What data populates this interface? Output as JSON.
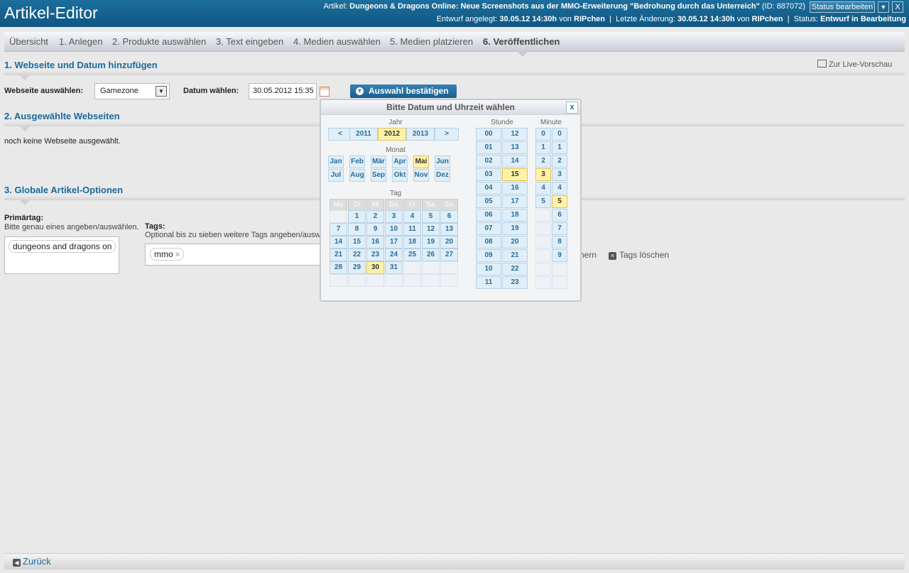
{
  "app": {
    "title": "Artikel-Editor"
  },
  "article": {
    "label": "Artikel:",
    "title": "Dungeons & Dragons Online: Neue Screenshots aus der MMO-Erweiterung \"Bedrohung durch das Unterreich\"",
    "id_text": "(ID: 887072)",
    "status_button": "Status bearbeiten",
    "draft_label": "Entwurf angelegt:",
    "draft_date": "30.05.12 14:30h",
    "by": "von",
    "draft_user": "RIPchen",
    "change_label": "Letzte Änderung:",
    "change_date": "30.05.12 14:30h",
    "change_user": "RIPchen",
    "status_label": "Status:",
    "status_value": "Entwurf in Bearbeitung"
  },
  "tabs": [
    "Übersicht",
    "1. Anlegen",
    "2. Produkte auswählen",
    "3. Text eingeben",
    "4. Medien auswählen",
    "5. Medien platzieren",
    "6. Veröffentlichen"
  ],
  "section1": {
    "title": "1. Webseite und Datum hinzufügen",
    "live_preview": "Zur Live-Vorschau",
    "website_label": "Webseite auswählen:",
    "website_value": "Gamezone",
    "date_label": "Datum wählen:",
    "date_value": "30.05.2012 15:35",
    "confirm_button": "Auswahl bestätigen"
  },
  "section2": {
    "title": "2. Ausgewählte Webseiten",
    "empty_note": "noch keine Webseite ausgewählt."
  },
  "section3": {
    "title": "3. Globale Artikel-Optionen",
    "primary_label": "Primärtag:",
    "primary_hint": "Bitte genau eines angeben/auswählen.",
    "primary_value": "dungeons and dragons on",
    "tags_label": "Tags:",
    "tags_hint": "Optional bis zu sieben weitere Tags angeben/ausw",
    "tag_chip": "mmo",
    "tag_chip_x": "×",
    "save_fragment": "hern",
    "clear_tags": "Tags löschen"
  },
  "footer": {
    "back": "Zurück"
  },
  "picker": {
    "title": "Bitte Datum und Uhrzeit wählen",
    "close": "x",
    "year_label": "Jahr",
    "prev": "<",
    "next": ">",
    "years": [
      "2011",
      "2012",
      "2013"
    ],
    "selected_year": "2012",
    "month_label": "Monat",
    "months": [
      "Jan",
      "Feb",
      "Mär",
      "Apr",
      "Mai",
      "Jun",
      "Jul",
      "Aug",
      "Sep",
      "Okt",
      "Nov",
      "Dez"
    ],
    "selected_month": "Mai",
    "day_label": "Tag",
    "weekdays": [
      "Mo",
      "Di",
      "Mi",
      "Do",
      "Fr",
      "Sa",
      "So"
    ],
    "days": [
      "1",
      "2",
      "3",
      "4",
      "5",
      "6",
      "7",
      "8",
      "9",
      "10",
      "11",
      "12",
      "13",
      "14",
      "15",
      "16",
      "17",
      "18",
      "19",
      "20",
      "21",
      "22",
      "23",
      "24",
      "25",
      "26",
      "27",
      "28",
      "29",
      "30",
      "31"
    ],
    "selected_day": "30",
    "hour_label": "Stunde",
    "hours": [
      "00",
      "01",
      "02",
      "03",
      "04",
      "05",
      "06",
      "07",
      "08",
      "09",
      "10",
      "11",
      "12",
      "13",
      "14",
      "15",
      "16",
      "17",
      "18",
      "19",
      "20",
      "21",
      "22",
      "23"
    ],
    "selected_hour": "15",
    "minute_label": "Minute",
    "minutes_tens": [
      "0",
      "1",
      "2",
      "3",
      "4",
      "5"
    ],
    "selected_tens": "3",
    "minutes_ones": [
      "0",
      "1",
      "2",
      "3",
      "4",
      "5",
      "6",
      "7",
      "8",
      "9"
    ],
    "selected_ones": "5"
  }
}
